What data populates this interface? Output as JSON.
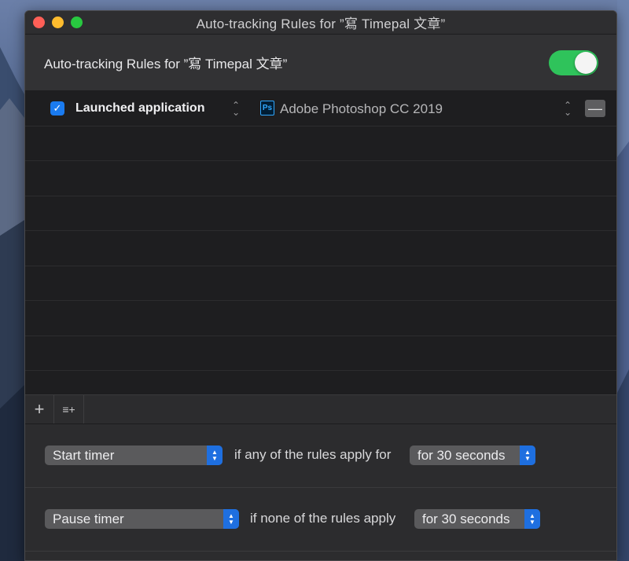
{
  "window": {
    "title": "Auto-tracking Rules for ”寫 Timepal 文章”"
  },
  "header": {
    "title": "Auto-tracking Rules for ”寫 Timepal 文章”",
    "toggle_on": true,
    "toggle_color": "#2fc35b"
  },
  "rules": [
    {
      "checked": true,
      "type": "Launched application",
      "app_icon": "photoshop-icon",
      "app_icon_text": "Ps",
      "app_name": "Adobe Photoshop CC 2019"
    }
  ],
  "toolbar": {
    "add_icon": "plus-icon",
    "add_symbol": "+",
    "add_list_icon": "add-list-icon",
    "add_list_symbol": "≡+"
  },
  "settings": {
    "start": {
      "action": "Start timer",
      "condition": "if any of the rules apply for",
      "duration": "for 30 seconds"
    },
    "pause": {
      "action": "Pause timer",
      "condition": "if none of the rules apply",
      "duration": "for 30 seconds"
    }
  },
  "colors": {
    "accent": "#1e6fe0",
    "checkbox": "#1a7bf0"
  }
}
